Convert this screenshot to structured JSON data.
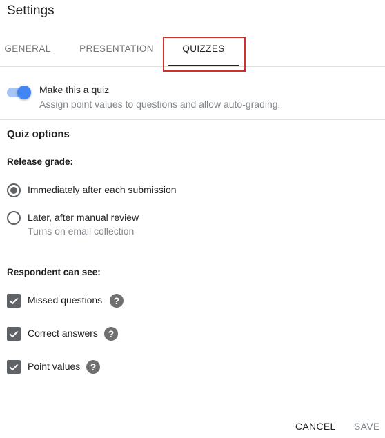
{
  "dialog": {
    "title": "Settings"
  },
  "tabs": [
    {
      "label": "GENERAL",
      "active": false
    },
    {
      "label": "PRESENTATION",
      "active": false
    },
    {
      "label": "QUIZZES",
      "active": true
    }
  ],
  "quiz_toggle": {
    "label": "Make this a quiz",
    "description": "Assign point values to questions and allow auto-grading.",
    "on": true
  },
  "quiz_options": {
    "title": "Quiz options",
    "release_grade": {
      "label": "Release grade:",
      "options": [
        {
          "label": "Immediately after each submission",
          "sublabel": "",
          "selected": true
        },
        {
          "label": "Later, after manual review",
          "sublabel": "Turns on email collection",
          "selected": false
        }
      ]
    },
    "respondent_can_see": {
      "label": "Respondent can see:",
      "options": [
        {
          "label": "Missed questions",
          "checked": true,
          "help_icon": "help-circle-icon"
        },
        {
          "label": "Correct answers",
          "checked": true,
          "help_icon": "help-circle-icon"
        },
        {
          "label": "Point values",
          "checked": true,
          "help_icon": "help-circle-icon"
        }
      ]
    }
  },
  "footer": {
    "cancel_label": "CANCEL",
    "save_label": "SAVE"
  },
  "colors": {
    "accent": "#4285f4",
    "highlight": "#d32f2f",
    "control": "#5f6368"
  }
}
